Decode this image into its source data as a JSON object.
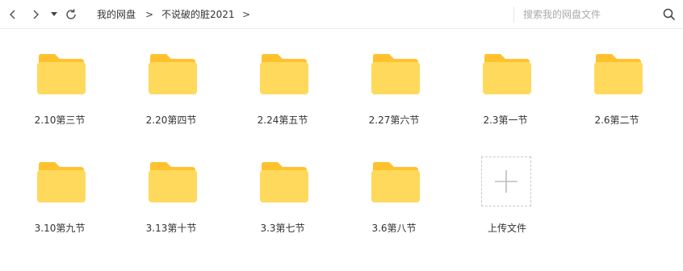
{
  "toolbar": {
    "back_icon": "chevron-left-icon",
    "forward_icon": "chevron-right-icon",
    "history_icon": "caret-down-icon",
    "refresh_icon": "refresh-icon"
  },
  "breadcrumb": {
    "items": [
      "我的网盘",
      "不说破的脏2021"
    ],
    "separator": ">"
  },
  "search": {
    "placeholder": "搜索我的网盘文件",
    "icon": "search-icon"
  },
  "folders": [
    {
      "name": "2.10第三节"
    },
    {
      "name": "2.20第四节"
    },
    {
      "name": "2.24第五节"
    },
    {
      "name": "2.27第六节"
    },
    {
      "name": "2.3第一节"
    },
    {
      "name": "2.6第二节"
    },
    {
      "name": "3.10第九节"
    },
    {
      "name": "3.13第十节"
    },
    {
      "name": "3.3第七节"
    },
    {
      "name": "3.6第八节"
    }
  ],
  "upload": {
    "label": "上传文件",
    "icon": "plus-icon"
  },
  "colors": {
    "folder_body": "#FFD95C",
    "folder_tab": "#FFC22E",
    "text": "#333333",
    "placeholder": "#AAAAAA"
  }
}
